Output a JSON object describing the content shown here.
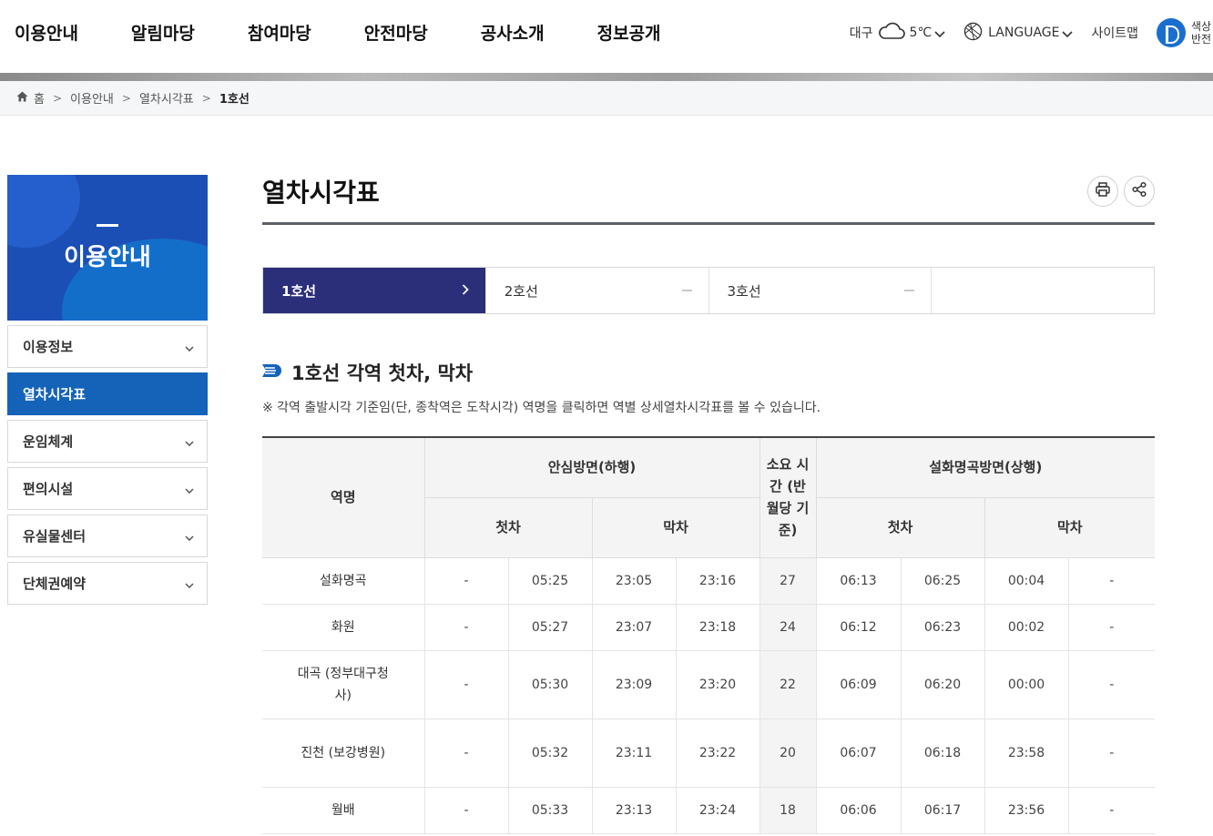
{
  "header": {
    "nav": [
      "이용안내",
      "알림마당",
      "참여마당",
      "안전마당",
      "공사소개",
      "정보공개"
    ],
    "weather_city": "대구",
    "temperature": "5℃",
    "language": "LANGUAGE",
    "sitemap": "사이트맵",
    "contrast": "색상반전"
  },
  "breadcrumb": [
    "홈",
    "이용안내",
    "열차시각표",
    "1호선"
  ],
  "sidebar": {
    "title": "이용안내",
    "items": [
      {
        "label": "이용정보",
        "active": false
      },
      {
        "label": "열차시각표",
        "active": true
      },
      {
        "label": "운임체계",
        "active": false
      },
      {
        "label": "편의시설",
        "active": false
      },
      {
        "label": "유실물센터",
        "active": false
      },
      {
        "label": "단체권예약",
        "active": false
      }
    ]
  },
  "content": {
    "page_title": "열차시각표",
    "tabs": [
      {
        "label": "1호선",
        "active": true
      },
      {
        "label": "2호선",
        "active": false
      },
      {
        "label": "3호선",
        "active": false
      },
      {
        "label": "",
        "active": false
      }
    ],
    "section_title": "1호선 각역 첫차, 막차",
    "notice": "※ 각역 출발시각 기준임(단, 종착역은 도착시각) 역명을 클릭하면 역별 상세열차시각표를 볼 수 있습니다.",
    "table": {
      "col_station": "역명",
      "col_down": "안심방면(하행)",
      "col_duration": "소요 시간 (반월당 기준)",
      "col_up": "설화명곡방면(상행)",
      "first": "첫차",
      "last": "막차",
      "rows": [
        {
          "station": "설화명곡",
          "d": [
            "-",
            "05:25",
            "23:05",
            "23:16"
          ],
          "dur": "27",
          "u": [
            "06:13",
            "06:25",
            "00:04",
            "-"
          ]
        },
        {
          "station": "화원",
          "d": [
            "-",
            "05:27",
            "23:07",
            "23:18"
          ],
          "dur": "24",
          "u": [
            "06:12",
            "06:23",
            "00:02",
            "-"
          ]
        },
        {
          "station": "대곡 (정부대구청사)",
          "d": [
            "-",
            "05:30",
            "23:09",
            "23:20"
          ],
          "dur": "22",
          "u": [
            "06:09",
            "06:20",
            "00:00",
            "-"
          ]
        },
        {
          "station": "진천 (보강병원)",
          "d": [
            "-",
            "05:32",
            "23:11",
            "23:22"
          ],
          "dur": "20",
          "u": [
            "06:07",
            "06:18",
            "23:58",
            "-"
          ]
        },
        {
          "station": "월배",
          "d": [
            "-",
            "05:33",
            "23:13",
            "23:24"
          ],
          "dur": "18",
          "u": [
            "06:06",
            "06:17",
            "23:56",
            "-"
          ]
        }
      ]
    }
  },
  "colors": {
    "brand_blue": "#1463b8",
    "active_tab": "#2b2f7a"
  }
}
